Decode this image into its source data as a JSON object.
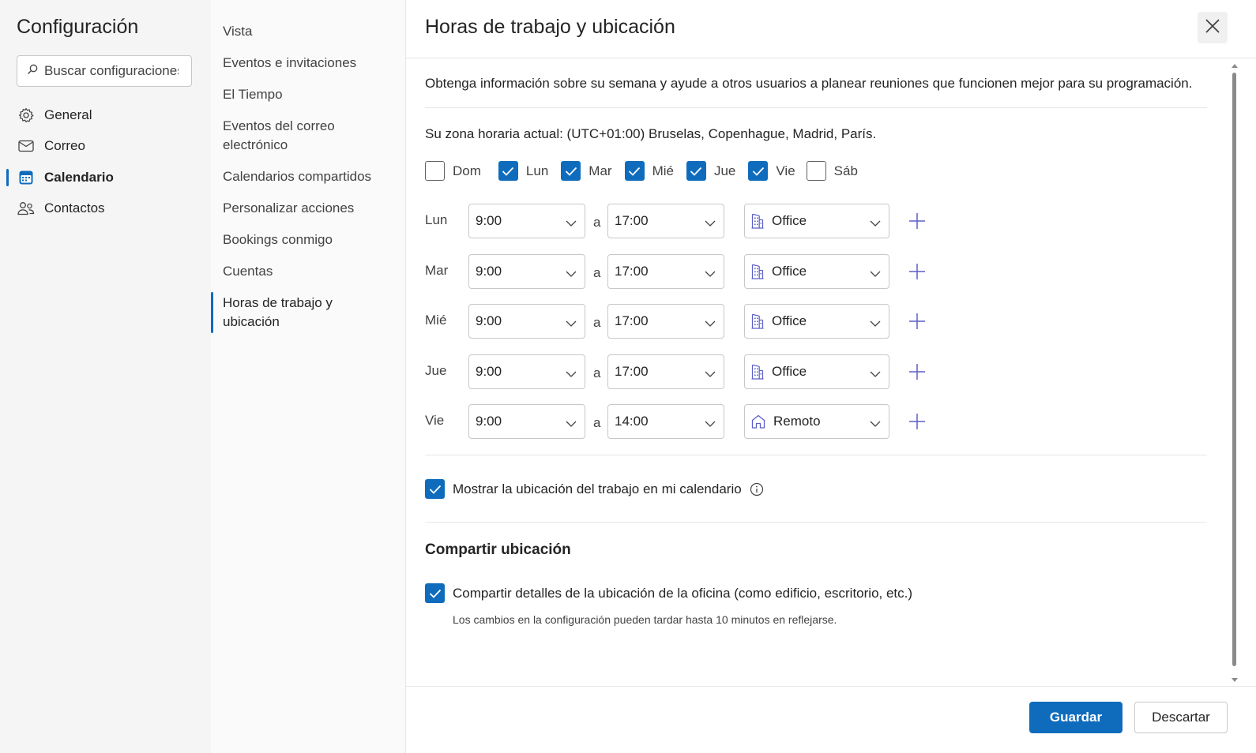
{
  "sidebar": {
    "title": "Configuración",
    "search_placeholder": "Buscar configuraciones",
    "items": [
      {
        "label": "General",
        "icon": "gear-icon"
      },
      {
        "label": "Correo",
        "icon": "mail-icon"
      },
      {
        "label": "Calendario",
        "icon": "calendar-icon",
        "active": true
      },
      {
        "label": "Contactos",
        "icon": "people-icon"
      }
    ]
  },
  "subnav": {
    "items": [
      {
        "label": "Vista"
      },
      {
        "label": "Eventos e invitaciones"
      },
      {
        "label": "El Tiempo"
      },
      {
        "label": "Eventos del correo electrónico"
      },
      {
        "label": "Calendarios compartidos"
      },
      {
        "label": "Personalizar acciones"
      },
      {
        "label": "Bookings conmigo"
      },
      {
        "label": "Cuentas"
      },
      {
        "label": "Horas de trabajo y ubicación",
        "active": true
      }
    ]
  },
  "panel": {
    "title": "Horas de trabajo y ubicación",
    "intro": "Obtenga información sobre su semana y ayude a otros usuarios a planear reuniones que funcionen mejor para su programación.",
    "timezone": "Su zona horaria actual: (UTC+01:00) Bruselas, Copenhague, Madrid, París.",
    "days": [
      {
        "label": "Dom",
        "checked": false
      },
      {
        "label": "Lun",
        "checked": true
      },
      {
        "label": "Mar",
        "checked": true
      },
      {
        "label": "Mié",
        "checked": true
      },
      {
        "label": "Jue",
        "checked": true
      },
      {
        "label": "Vie",
        "checked": true
      },
      {
        "label": "Sáb",
        "checked": false
      }
    ],
    "to_label": "a",
    "schedule": [
      {
        "day": "Lun",
        "start": "9:00",
        "end": "17:00",
        "location": "Office",
        "location_icon": "building-icon"
      },
      {
        "day": "Mar",
        "start": "9:00",
        "end": "17:00",
        "location": "Office",
        "location_icon": "building-icon"
      },
      {
        "day": "Mié",
        "start": "9:00",
        "end": "17:00",
        "location": "Office",
        "location_icon": "building-icon"
      },
      {
        "day": "Jue",
        "start": "9:00",
        "end": "17:00",
        "location": "Office",
        "location_icon": "building-icon"
      },
      {
        "day": "Vie",
        "start": "9:00",
        "end": "14:00",
        "location": "Remoto",
        "location_icon": "home-icon"
      }
    ],
    "show_location": {
      "label": "Mostrar la ubicación del trabajo en mi calendario",
      "checked": true
    },
    "share_title": "Compartir ubicación",
    "share_details": {
      "label": "Compartir detalles de la ubicación de la oficina (como edificio, escritorio, etc.)",
      "checked": true
    },
    "share_note": "Los cambios en la configuración pueden tardar hasta 10 minutos en reflejarse.",
    "save_label": "Guardar",
    "discard_label": "Descartar"
  },
  "colors": {
    "accent": "#0f6cbd",
    "sidebar_bg": "#f5f5f5",
    "subnav_bg": "#fafafa"
  }
}
